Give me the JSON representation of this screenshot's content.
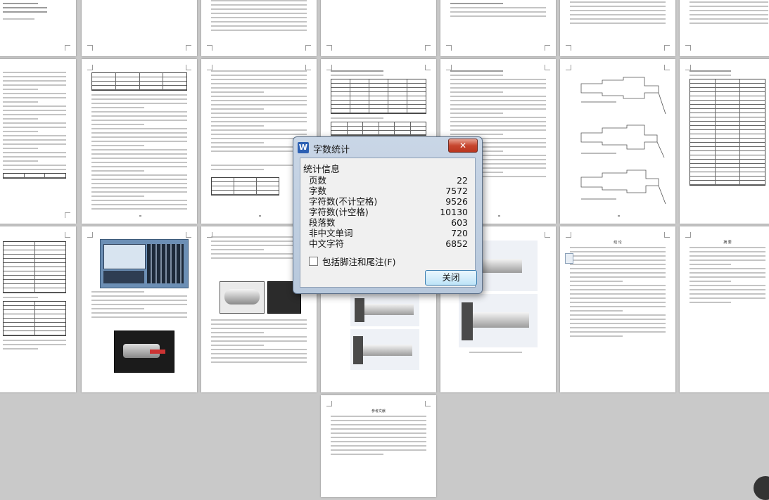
{
  "dialog": {
    "title": "字数统计",
    "app_icon_letter": "W",
    "close_x": "✕",
    "section_title": "统计信息",
    "stats": [
      {
        "label": "页数",
        "value": "22"
      },
      {
        "label": "字数",
        "value": "7572"
      },
      {
        "label": "字符数(不计空格)",
        "value": "9526"
      },
      {
        "label": "字符数(计空格)",
        "value": "10130"
      },
      {
        "label": "段落数",
        "value": "603"
      },
      {
        "label": "非中文单词",
        "value": "720"
      },
      {
        "label": "中文字符",
        "value": "6852"
      }
    ],
    "checkbox_label": "包括脚注和尾注(F)",
    "checkbox_checked": false,
    "close_button": "关闭"
  },
  "pages": {
    "abstract_heading": "摘  要",
    "conclusion_heading": "结  论",
    "references_heading": "参考文献"
  },
  "colors": {
    "background": "#c9c9c9",
    "dialog_frame": "#b7c8dc",
    "close_red": "#c7462e",
    "button_blue": "#3c7fb1"
  }
}
